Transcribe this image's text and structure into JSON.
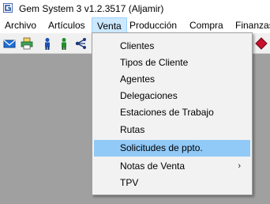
{
  "window": {
    "title": "Gem System 3 v1.2.3517 (Aljamir)"
  },
  "menubar": {
    "items": [
      {
        "label": "Archivo"
      },
      {
        "label": "Artículos"
      },
      {
        "label": "Venta",
        "active": true
      },
      {
        "label": "Producción"
      },
      {
        "label": "Compra"
      },
      {
        "label": "Finanzas"
      }
    ]
  },
  "toolbar": {
    "icons": [
      "mail-icon",
      "printer-icon",
      "person-blue-icon",
      "person-green-icon",
      "network-icon",
      "red-diamond-icon"
    ]
  },
  "venta_menu": {
    "items": [
      {
        "label": "Clientes"
      },
      {
        "label": "Tipos de Cliente"
      },
      {
        "label": "Agentes"
      },
      {
        "label": "Delegaciones"
      },
      {
        "label": "Estaciones de Trabajo"
      },
      {
        "label": "Rutas"
      },
      {
        "label": "Solicitudes de ppto.",
        "highlighted": true
      },
      {
        "label": "Notas de Venta",
        "submenu_arrow": "›"
      },
      {
        "label": "TPV"
      }
    ]
  },
  "colors": {
    "highlight": "#91c9f7",
    "workspace": "#a0a0a0",
    "menu_active": "#cce8ff"
  }
}
